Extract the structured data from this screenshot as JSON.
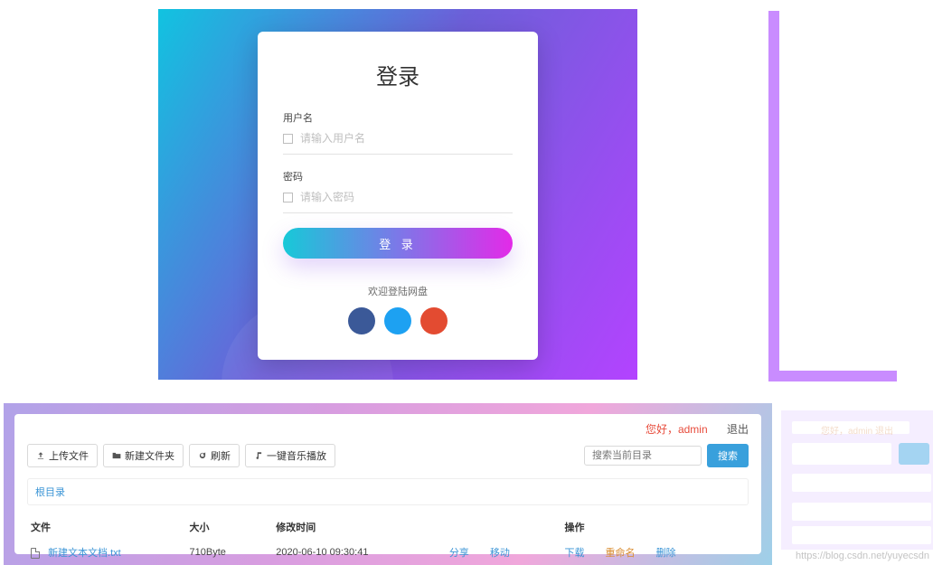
{
  "login": {
    "title": "登录",
    "username_label": "用户名",
    "username_placeholder": "请输入用户名",
    "password_label": "密码",
    "password_placeholder": "请输入密码",
    "submit_label": "登 录",
    "welcome_text": "欢迎登陆网盘",
    "circle_colors": [
      "#3b5998",
      "#1da1f2",
      "#e34b31"
    ]
  },
  "fm": {
    "greeting_prefix": "您好，",
    "greeting_user": "admin",
    "logout_label": "退出",
    "toolbar": {
      "upload": "上传文件",
      "new_folder": "新建文件夹",
      "refresh": "刷新",
      "music_play": "一键音乐播放"
    },
    "search_placeholder": "搜索当前目录",
    "search_button": "搜索",
    "breadcrumb": "根目录",
    "columns": {
      "file": "文件",
      "size": "大小",
      "mtime": "修改时间",
      "ops": "操作"
    },
    "actions": {
      "share": "分享",
      "move": "移动",
      "download": "下载",
      "rename": "重命名",
      "delete": "删除"
    },
    "rows": [
      {
        "name": "新建文本文档.txt",
        "size": "710Byte",
        "mtime": "2020-06-10 09:30:41"
      }
    ]
  },
  "ghost_greeting": "您好，admin    退出",
  "watermark": "https://blog.csdn.net/yuyecsdn"
}
